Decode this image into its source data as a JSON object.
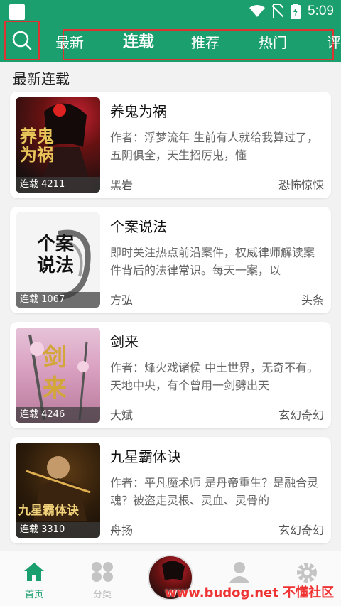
{
  "status": {
    "time": "5:09"
  },
  "tabs": [
    {
      "label": "最新",
      "active": false
    },
    {
      "label": "连载",
      "active": true
    },
    {
      "label": "推荐",
      "active": false
    },
    {
      "label": "热门",
      "active": false
    },
    {
      "label": "评",
      "active": false
    }
  ],
  "section_title": "最新连载",
  "books": [
    {
      "title": "养鬼为祸",
      "desc": "作者：浮梦流年  生前有人就给我算过了，五阴俱全，天生招厉鬼，懂",
      "author": "黑岩",
      "genre": "恐怖惊悚",
      "badge": "连载 4211",
      "cover_text": "养鬼为祸"
    },
    {
      "title": "个案说法",
      "desc": "即时关注热点前沿案件，权威律师解读案件背后的法律常识。每天一案，以",
      "author": "方弘",
      "genre": "头条",
      "badge": "连载 1067",
      "cover_text": "个案说法"
    },
    {
      "title": "剑来",
      "desc": "作者：烽火戏诸侯 中土世界，无奇不有。天地中央，有个曾用一剑劈出天",
      "author": "大斌",
      "genre": "玄幻奇幻",
      "badge": "连载 4246",
      "cover_text": "剑来"
    },
    {
      "title": "九星霸体诀",
      "desc": "作者：平凡魔术师 是丹帝重生？是融合灵魂？被盗走灵根、灵血、灵骨的",
      "author": "舟扬",
      "genre": "玄幻奇幻",
      "badge": "连载 3310",
      "cover_text": "九星霸体诀"
    }
  ],
  "nav": [
    {
      "label": "首页",
      "icon": "home-icon",
      "active": true
    },
    {
      "label": "分类",
      "icon": "category-icon",
      "active": false
    },
    {
      "label": "",
      "icon": "profile-icon",
      "active": false
    },
    {
      "label": "",
      "icon": "settings-icon",
      "active": false
    }
  ],
  "watermark": "www.budog.net 不懂社区",
  "colors": {
    "primary": "#1c9f6e",
    "highlight_box": "#dd3333"
  }
}
